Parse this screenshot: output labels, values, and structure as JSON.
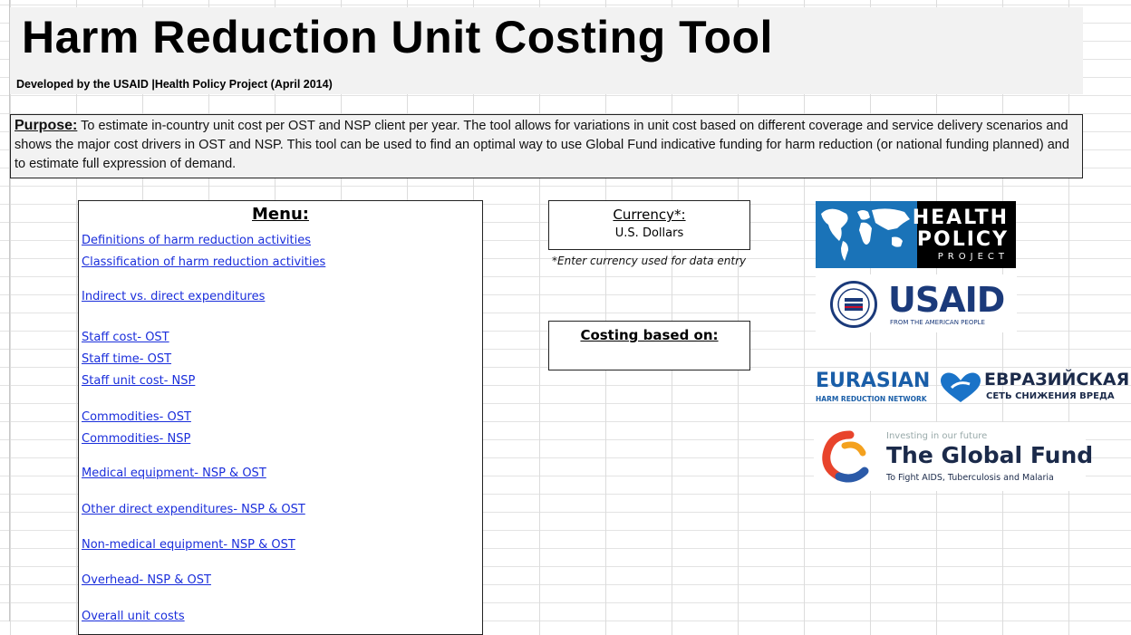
{
  "title": "Harm Reduction Unit Costing Tool",
  "subtitle": "Developed by the USAID |Health Policy Project (April 2014)",
  "purpose": {
    "label": "Purpose:",
    "text": " To estimate in-country unit cost per OST and NSP client per year. The tool allows for variations in unit cost based on different coverage and service delivery scenarios and shows the major cost drivers in OST and NSP. This tool can be used to find an optimal way to use Global Fund indicative funding for harm reduction (or national funding planned) and to estimate full expression of demand."
  },
  "menu": {
    "heading": "Menu:",
    "links": [
      "Definitions of harm reduction activities",
      "Classification of harm reduction activities",
      "Indirect vs. direct expenditures",
      "Staff cost- OST",
      "Staff time- OST",
      "Staff unit cost- NSP",
      "Commodities- OST",
      "Commodities- NSP",
      "Medical equipment- NSP & OST",
      "Other direct expenditures- NSP & OST",
      "Non-medical equipment- NSP & OST",
      "Overhead- NSP & OST",
      "Overall unit costs"
    ]
  },
  "currency": {
    "label": "Currency*:",
    "value": "U.S. Dollars",
    "note": "*Enter currency used for data entry"
  },
  "costing": {
    "label": "Costing based on:"
  },
  "logos": {
    "hpp": {
      "line1": "HEALTH",
      "line2": "POLICY",
      "line3": "PROJECT"
    },
    "usaid": {
      "word": "USAID",
      "tagline": "FROM THE AMERICAN PEOPLE"
    },
    "ehrn": {
      "name_en": "EURASIAN",
      "sub_en": "HARM REDUCTION NETWORK",
      "name_ru": "ЕВРАЗИЙСКАЯ",
      "sub_ru": "СЕТЬ СНИЖЕНИЯ ВРЕДА"
    },
    "global_fund": {
      "tagline_top": "Investing in our future",
      "name": "The Global Fund",
      "tagline_bottom": "To Fight AIDS, Tuberculosis and Malaria"
    }
  },
  "colors": {
    "link": "#1a2edb",
    "usaid_blue": "#1b3a7a",
    "ehrn_blue": "#1a5ea8",
    "hpp_blue": "#1a73b8"
  }
}
